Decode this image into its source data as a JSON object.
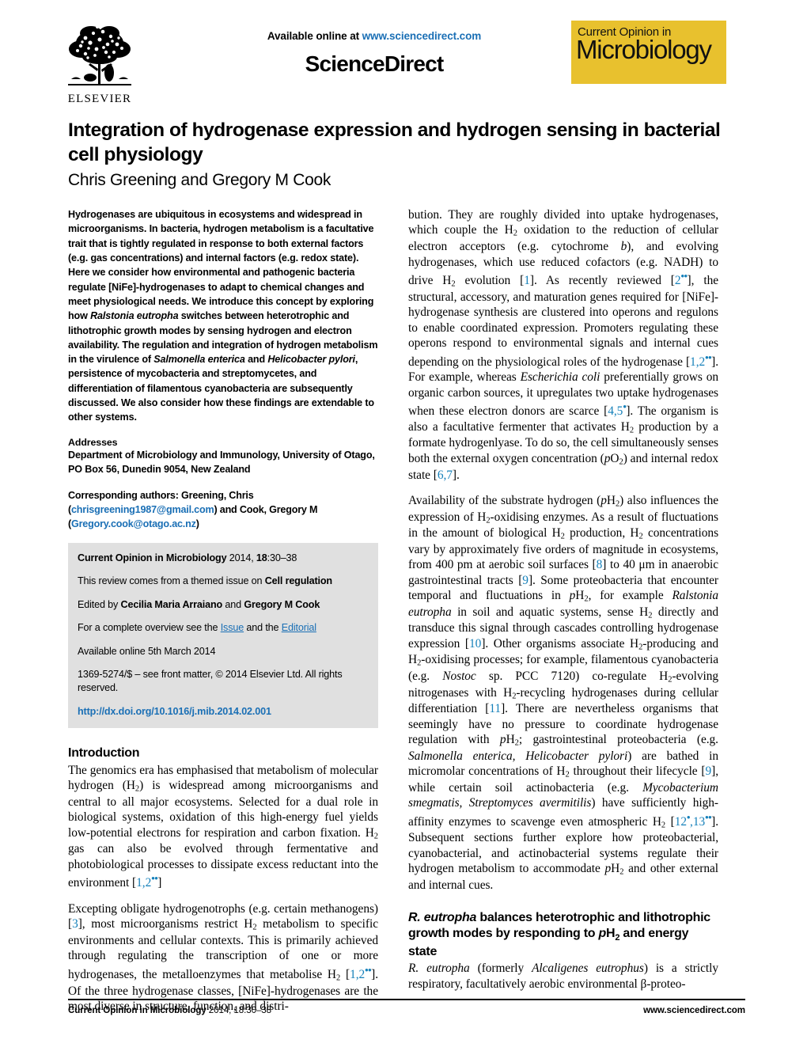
{
  "masthead": {
    "available_online": "Available online at",
    "sciencedirect_url": "www.sciencedirect.com",
    "sciencedirect_wordmark": "ScienceDirect",
    "elsevier_wordmark": "ELSEVIER",
    "journal_logo_top": "Current Opinion in",
    "journal_logo_main": "Microbiology",
    "journal_logo_color": "#E8C12E",
    "link_color": "#1A6FB5"
  },
  "title_block": {
    "title": "Integration of hydrogenase expression and hydrogen sensing in bacterial cell physiology",
    "authors": "Chris Greening and Gregory M Cook"
  },
  "abstract": {
    "text_part1": "Hydrogenases are ubiquitous in ecosystems and widespread in microorganisms. In bacteria, hydrogen metabolism is a facultative trait that is tightly regulated in response to both external factors (e.g. gas concentrations) and internal factors (e.g. redox state). Here we consider how environmental and pathogenic bacteria regulate [NiFe]-hydrogenases to adapt to chemical changes and meet physiological needs. We introduce this concept by exploring how ",
    "italic1": "Ralstonia eutropha",
    "text_part2": " switches between heterotrophic and lithotrophic growth modes by sensing hydrogen and electron availability. The regulation and integration of hydrogen metabolism in the virulence of ",
    "italic2": "Salmonella enterica",
    "text_part3": " and ",
    "italic3": "Helicobacter pylori",
    "text_part4": ", persistence of mycobacteria and streptomycetes, and differentiation of filamentous cyanobacteria are subsequently discussed. We also consider how these findings are extendable to other systems."
  },
  "addresses": {
    "heading": "Addresses",
    "line1": "Department of Microbiology and Immunology, University of Otago,",
    "line2": "PO Box 56, Dunedin 9054, New Zealand"
  },
  "corresponding": {
    "prefix": "Corresponding authors: Greening, Chris (",
    "email1": "chrisgreening1987@gmail.com",
    "middle": ") and Cook, Gregory M (",
    "email2": "Gregory.cook@otago.ac.nz",
    "suffix": ")"
  },
  "infobox": {
    "citation_journal": "Current Opinion in Microbiology",
    "citation_year": " 2014, ",
    "citation_volume": "18",
    "citation_pages": ":30–38",
    "themed_prefix": "This review comes from a themed issue on ",
    "themed_topic": "Cell regulation",
    "edited_prefix": "Edited by ",
    "editor1": "Cecilia Maria Arraiano",
    "edited_join": " and ",
    "editor2": "Gregory M Cook",
    "overview_prefix": "For a complete overview see the ",
    "overview_link1": "Issue",
    "overview_join": " and the ",
    "overview_link2": "Editorial",
    "available_online": "Available online 5th March 2014",
    "frontmatter": "1369-5274/$ – see front matter, © 2014 Elsevier Ltd. All rights reserved.",
    "doi": "http://dx.doi.org/10.1016/j.mib.2014.02.001"
  },
  "introduction": {
    "heading": "Introduction",
    "para1": {
      "t1": "The genomics era has emphasised that metabolism of molecular hydrogen (H",
      "sub1": "2",
      "t2": ") is widespread among microorganisms and central to all major ecosystems. Selected for a dual role in biological systems, oxidation of this high-energy fuel yields low-potential electrons for respiration and carbon fixation. H",
      "sub2": "2",
      "t3": " gas can also be evolved through fermentative and photobiological processes to dissipate excess reductant into the environment [",
      "ref1": "1,2",
      "stars1": "••",
      "t4": "]"
    },
    "para2": {
      "t1": "Excepting obligate hydrogenotrophs (e.g. certain methanogens) [",
      "ref1": "3",
      "t2": "], most microorganisms restrict H",
      "sub1": "2",
      "t3": " metabolism to specific environments and cellular contexts. This is primarily achieved through regulating the transcription of one or more hydrogenases, the metalloenzymes that metabolise H",
      "sub2": "2",
      "t4": " [",
      "ref2": "1,2",
      "stars2": "••",
      "t5": "]. Of the three hydrogenase classes, [NiFe]-hydrogenases are the most diverse in structure, function, and distri-"
    }
  },
  "right_column": {
    "para1": {
      "t1": "bution. They are roughly divided into uptake hydrogenases, which couple the H",
      "sub1": "2",
      "t2": " oxidation to the reduction of cellular electron acceptors (e.g. cytochrome ",
      "it1": "b",
      "t3": "), and evolving hydrogenases, which use reduced cofactors (e.g. NADH) to drive H",
      "sub2": "2",
      "t4": " evolution [",
      "ref1": "1",
      "t5": "]. As recently reviewed [",
      "ref2": "2",
      "stars2": "••",
      "t6": "], the structural, accessory, and maturation genes required for [NiFe]-hydrogenase synthesis are clustered into operons and regulons to enable coordinated expression. Promoters regulating these operons respond to environmental signals and internal cues depending on the physiological roles of the hydrogenase [",
      "ref3": "1,2",
      "stars3": "••",
      "t7": "]. For example, whereas ",
      "it2": "Escherichia coli",
      "t8": " preferentially grows on organic carbon sources, it upregulates two uptake hydrogenases when these electron donors are scarce [",
      "ref4": "4,5",
      "stars4": "•",
      "t9": "]. The organism is also a facultative fermenter that activates H",
      "sub3": "2",
      "t10": " production by a formate hydrogenlyase. To do so, the cell simultaneously senses both the external oxygen concentration (",
      "it3": "p",
      "t11": "O",
      "sub4": "2",
      "t12": ") and internal redox state [",
      "ref5": "6,7",
      "t13": "]."
    },
    "para2": {
      "t1": "Availability of the substrate hydrogen (",
      "it1": "p",
      "t2": "H",
      "sub1": "2",
      "t3": ") also influences the expression of H",
      "sub2": "2",
      "t4": "-oxidising enzymes. As a result of fluctuations in the amount of biological H",
      "sub3": "2",
      "t5": " production, H",
      "sub4": "2",
      "t6": " concentrations vary by approximately five orders of magnitude in ecosystems, from 400 pm at aerobic soil surfaces [",
      "ref1": "8",
      "t7": "] to 40 μm in anaerobic gastrointestinal tracts [",
      "ref2": "9",
      "t8": "]. Some proteobacteria that encounter temporal and fluctuations in ",
      "it2": "p",
      "t9": "H",
      "sub5": "2",
      "t10": ", for example ",
      "it3": "Ralstonia eutropha",
      "t11": " in soil and aquatic systems, sense H",
      "sub6": "2",
      "t12": " directly and transduce this signal through cascades controlling hydrogenase expression [",
      "ref3": "10",
      "t13": "]. Other organisms associate H",
      "sub7": "2",
      "t14": "-producing and H",
      "sub8": "2",
      "t15": "-oxidising processes; for example, filamentous cyanobacteria (e.g. ",
      "it4": "Nostoc",
      "t16": " sp. PCC 7120) co-regulate H",
      "sub9": "2",
      "t17": "-evolving nitrogenases with H",
      "sub10": "2",
      "t18": "-recycling hydrogenases during cellular differentiation [",
      "ref4": "11",
      "t19": "]. There are nevertheless organisms that seemingly have no pressure to coordinate hydrogenase regulation with ",
      "it5": "p",
      "t20": "H",
      "sub11": "2",
      "t21": "; gastrointestinal proteobacteria (e.g. ",
      "it6": "Salmonella enterica, Helicobacter pylori",
      "t22": ") are bathed in micromolar concentrations of H",
      "sub12": "2",
      "t23": " throughout their lifecycle [",
      "ref5": "9",
      "t24": "], while certain soil actinobacteria (e.g. ",
      "it7": "Mycobacterium smegmatis, Streptomyces avermitilis",
      "t25": ") have sufficiently high-affinity enzymes to scavenge even atmospheric H",
      "sub13": "2",
      "t26": " [",
      "ref6": "12",
      "stars6": "•",
      "t27": ",",
      "ref7": "13",
      "stars7": "••",
      "t28": "]. Subsequent sections further explore how proteobacterial, cyanobacterial, and actinobacterial systems regulate their hydrogen metabolism to accommodate ",
      "it8": "p",
      "t29": "H",
      "sub14": "2",
      "t30": " and other external and internal cues."
    },
    "section2": {
      "heading_it1": "R. eutropha",
      "heading_t1": " balances heterotrophic and lithotrophic growth modes by responding to ",
      "heading_p": "p",
      "heading_t2": "H",
      "heading_sub": "2",
      "heading_t3": " and energy state",
      "para_it1": "R. eutropha",
      "para_t1": " (formerly ",
      "para_it2": "Alcaligenes eutrophus",
      "para_t2": ") is a strictly respiratory, facultatively aerobic environmental β-proteo-"
    }
  },
  "footer": {
    "left_journal": "Current Opinion in Microbiology",
    "left_rest": " 2014, 18:30–38",
    "right": "www.sciencedirect.com"
  }
}
